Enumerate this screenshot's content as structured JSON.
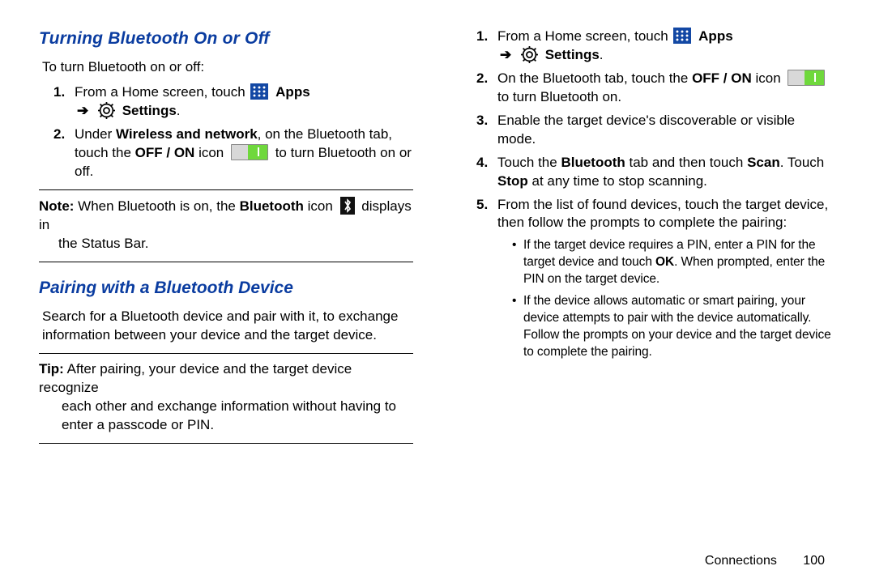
{
  "left": {
    "heading1": "Turning Bluetooth On or Off",
    "intro": "To turn Bluetooth on or off:",
    "step1_a": "From a Home screen, touch ",
    "apps_label": "Apps",
    "settings_label": "Settings",
    "arrow": "➔",
    "period": ".",
    "step2_a": "Under ",
    "step2_b": "Wireless and network",
    "step2_c": ", on the Bluetooth tab, touch the ",
    "step2_d": "OFF / ON",
    "step2_e": " icon ",
    "step2_f": " to turn Bluetooth on or off.",
    "note_label": "Note:",
    "note_a": " When Bluetooth is on, the ",
    "note_b": "Bluetooth",
    "note_c": " icon ",
    "note_d": " displays in",
    "note_e": "the Status Bar.",
    "heading2": "Pairing with a Bluetooth Device",
    "para2a": "Search for a Bluetooth device and pair with it, to exchange information between your device and the target device.",
    "tip_label": "Tip:",
    "tip_a": " After pairing, your device and the target device recognize",
    "tip_b": "each other and exchange information without having to enter a passcode or PIN."
  },
  "right": {
    "step1_a": "From a Home screen, touch ",
    "apps_label": "Apps",
    "arrow": "➔",
    "settings_label": "Settings",
    "period": ".",
    "step2_a": "On the Bluetooth tab, touch the ",
    "step2_b": "OFF / ON",
    "step2_c": " icon ",
    "step2_d": " to turn Bluetooth on.",
    "step3": "Enable the target device's discoverable or visible mode.",
    "step4_a": "Touch the ",
    "step4_b": "Bluetooth",
    "step4_c": " tab and then touch ",
    "step4_d": "Scan",
    "step4_e": ". Touch ",
    "step4_f": "Stop",
    "step4_g": " at any time to stop scanning.",
    "step5": "From the list of found devices, touch the target device, then follow the prompts to complete the pairing:",
    "bullet1_a": "If the target device requires a PIN, enter a PIN for the target device and touch ",
    "bullet1_b": "OK",
    "bullet1_c": ". When prompted, enter the PIN on the target device.",
    "bullet2": "If the device allows automatic or smart pairing, your device attempts to pair with the device automatically. Follow the prompts on your device and the target device to complete the pairing."
  },
  "nums": {
    "n1": "1.",
    "n2": "2.",
    "n3": "3.",
    "n4": "4.",
    "n5": "5."
  },
  "bullet": "•",
  "footer": {
    "section": "Connections",
    "page": "100"
  }
}
